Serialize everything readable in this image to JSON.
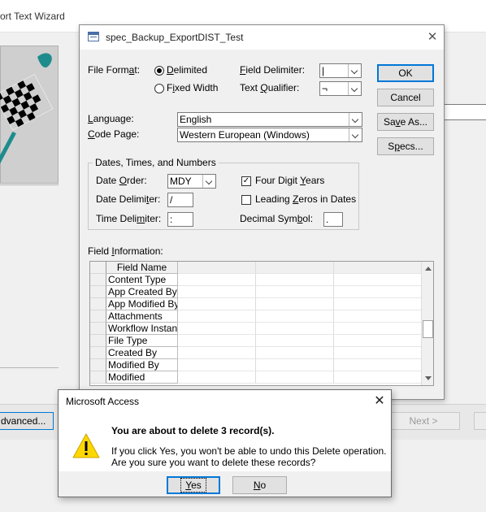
{
  "background_window": {
    "title": "ort Text Wizard",
    "buttons": {
      "advanced": "dvanced...",
      "next": "Next >"
    }
  },
  "spec_dialog": {
    "title": "spec_Backup_ExportDIST_Test",
    "close_icon": "close-icon",
    "file_format": {
      "label_pre": "File Form",
      "label_u": "a",
      "label_post": "t:",
      "options": [
        {
          "pre": "",
          "u": "D",
          "post": "elimited",
          "selected": true
        },
        {
          "pre": "F",
          "u": "i",
          "post": "xed Width",
          "selected": false
        }
      ]
    },
    "field_delimiter": {
      "label_pre": "",
      "label_u": "F",
      "label_post": "ield Delimiter:",
      "value": "|"
    },
    "text_qualifier": {
      "label_pre": "Text ",
      "label_u": "Q",
      "label_post": "ualifier:",
      "value": "¬"
    },
    "language": {
      "label_pre": "",
      "label_u": "L",
      "label_post": "anguage:",
      "value": "English"
    },
    "code_page": {
      "label_pre": "",
      "label_u": "C",
      "label_post": "ode Page:",
      "value": "Western European (Windows)"
    },
    "buttons": {
      "ok": "OK",
      "cancel": "Cancel",
      "save_as": {
        "pre": "Sa",
        "u": "v",
        "post": "e As..."
      },
      "specs": {
        "pre": "S",
        "u": "p",
        "post": "ecs..."
      }
    },
    "dates_group": {
      "legend": "Dates, Times, and Numbers",
      "date_order": {
        "label_pre": "Date ",
        "label_u": "O",
        "label_post": "rder:",
        "value": "MDY"
      },
      "date_delimiter": {
        "label_pre": "Date Delimi",
        "label_u": "t",
        "label_post": "er:",
        "value": "/"
      },
      "time_delimiter": {
        "label_pre": "Time Deli",
        "label_u": "m",
        "label_post": "iter:",
        "value": ":"
      },
      "four_digit_years": {
        "label_pre": "Four Digit ",
        "label_u": "Y",
        "label_post": "ears",
        "checked": true
      },
      "leading_zeros": {
        "label_pre": "Leading ",
        "label_u": "Z",
        "label_post": "eros in Dates",
        "checked": false
      },
      "decimal_symbol": {
        "label_pre": "Decimal Sym",
        "label_u": "b",
        "label_post": "ol:",
        "value": "."
      }
    },
    "field_info": {
      "label_pre": "Field ",
      "label_u": "I",
      "label_post": "nformation:",
      "column_header": "Field Name",
      "rows": [
        "Content Type",
        "App Created By",
        "App Modified By",
        "Attachments",
        "Workflow Instanc",
        "File Type",
        "Created By",
        "Modified By",
        "Modified"
      ]
    }
  },
  "confirm_dialog": {
    "title": "Microsoft Access",
    "icon": "warning-icon",
    "heading": "You are about to delete 3 record(s).",
    "line1": "If you click Yes, you won't be able to undo this Delete operation.",
    "line2": "Are you sure you want to delete these records?",
    "yes": {
      "u": "Y",
      "post": "es"
    },
    "no": {
      "u": "N",
      "post": "o"
    }
  }
}
